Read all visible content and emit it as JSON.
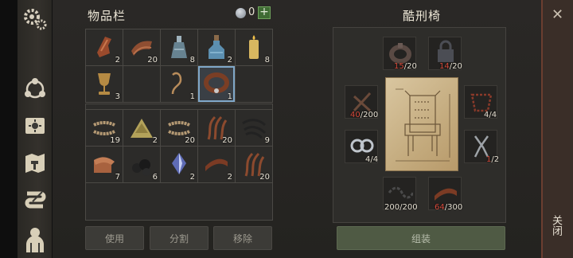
{
  "inventory": {
    "title": "物品栏",
    "coins": "0",
    "add_label": "+",
    "top_rows": [
      [
        {
          "icon": "leather-pouch-icon",
          "count": "2"
        },
        {
          "icon": "leather-scroll-icon",
          "count": "20"
        },
        {
          "icon": "glass-bottle-icon",
          "count": "8"
        },
        {
          "icon": "potion-bottle-icon",
          "count": "2"
        },
        {
          "icon": "candle-icon",
          "count": "8"
        }
      ],
      [
        {
          "icon": "goblet-icon",
          "count": "3"
        },
        {
          "icon": "",
          "count": ""
        },
        {
          "icon": "rope-icon",
          "count": "1"
        },
        {
          "icon": "collar-icon",
          "count": "1",
          "selected": true
        },
        {
          "icon": "",
          "count": ""
        }
      ]
    ],
    "bottom_rows": [
      [
        {
          "icon": "rope-coil-icon",
          "count": "19"
        },
        {
          "icon": "sand-pile-icon",
          "count": "2"
        },
        {
          "icon": "rope-coil-icon",
          "count": "20"
        },
        {
          "icon": "fiber-bundle-icon",
          "count": "20"
        },
        {
          "icon": "black-cord-icon",
          "count": "9"
        }
      ],
      [
        {
          "icon": "leather-roll-icon",
          "count": "7"
        },
        {
          "icon": "coal-icon",
          "count": "6"
        },
        {
          "icon": "crystal-icon",
          "count": "2"
        },
        {
          "icon": "leather-strap-icon",
          "count": "2"
        },
        {
          "icon": "fiber-bundle-icon",
          "count": "20"
        }
      ]
    ],
    "buttons": {
      "use": "使用",
      "split": "分割",
      "remove": "移除"
    }
  },
  "craft": {
    "title": "酷刑椅",
    "assemble_label": "组装",
    "requirements": [
      {
        "icon": "iron-collar-icon",
        "have": "15",
        "need": "/20",
        "lacking": true
      },
      {
        "icon": "iron-lock-icon",
        "have": "14",
        "need": "/20",
        "lacking": true
      },
      {
        "icon": "iron-nails-icon",
        "have": "40",
        "need": "/200",
        "lacking": true
      },
      {
        "icon": "rope-frame-icon",
        "have": "4",
        "need": "/4",
        "lacking": false
      },
      {
        "icon": "shackles-icon",
        "have": "4",
        "need": "/4",
        "lacking": false
      },
      {
        "icon": "pliers-icon",
        "have": "1",
        "need": "/2",
        "lacking": true
      },
      {
        "icon": "chain-icon",
        "have": "200",
        "need": "/200",
        "lacking": false
      },
      {
        "icon": "leather-strap-icon",
        "have": "64",
        "need": "/300",
        "lacking": true
      }
    ]
  },
  "close": {
    "label": "关闭",
    "x": "✕"
  },
  "colors": {
    "lacking": "#d64a3b",
    "assemble": "#4f5a44"
  }
}
